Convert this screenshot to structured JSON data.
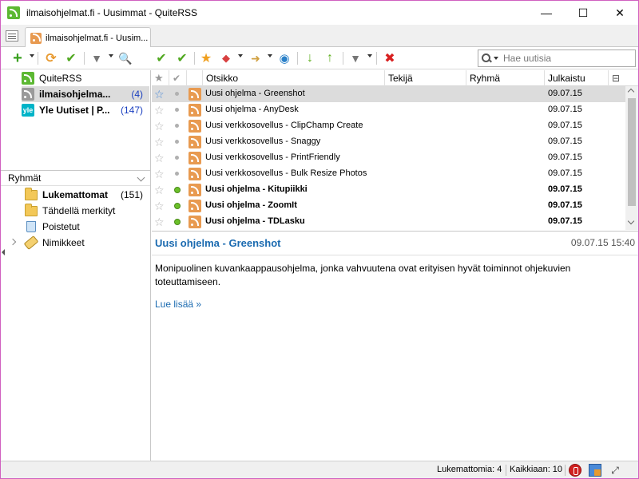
{
  "window": {
    "title": "ilmaisohjelmat.fi - Uusimmat - QuiteRSS",
    "controls": {
      "minimize": "—",
      "maximize": "☐",
      "close": "✕"
    }
  },
  "tabs": [
    {
      "label": "ilmaisohjelmat.fi - Uusim..."
    }
  ],
  "toolbar": {
    "left_icons": [
      "add-feed-icon",
      "update-icon",
      "mark-read-icon",
      "filter-icon",
      "find-feed-icon"
    ],
    "news_icons": [
      "mark-news-read-icon",
      "mark-all-read-icon",
      "star-icon",
      "label-icon",
      "share-icon",
      "open-browser-icon",
      "next-unread-icon",
      "prev-unread-icon",
      "news-filter-icon",
      "delete-icon"
    ]
  },
  "search": {
    "placeholder": "Hae uutisia"
  },
  "feeds": [
    {
      "label": "QuiteRSS",
      "count": "",
      "icon": "green",
      "bold": false
    },
    {
      "label": "ilmaisohjelma...",
      "count": "(4)",
      "icon": "gray",
      "bold": true
    },
    {
      "label": "Yle Uutiset | P...",
      "count": "(147)",
      "icon": "yle",
      "bold": true
    }
  ],
  "yle_icon_text": "yle",
  "groups": {
    "header": "Ryhmät",
    "items": [
      {
        "label": "Lukemattomat",
        "count": "(151)",
        "bold": true
      },
      {
        "label": "Tähdellä merkityt",
        "count": "",
        "bold": false
      },
      {
        "label": "Poistetut",
        "count": "",
        "bold": false
      },
      {
        "label": "Nimikkeet",
        "count": "",
        "bold": false
      }
    ]
  },
  "news_columns": {
    "title": "Otsikko",
    "author": "Tekijä",
    "category": "Ryhmä",
    "published": "Julkaistu"
  },
  "news": [
    {
      "title": "Uusi ohjelma - Greenshot",
      "date": "09.07.15",
      "unread": false,
      "starred": true,
      "selected": true
    },
    {
      "title": "Uusi ohjelma - AnyDesk",
      "date": "09.07.15",
      "unread": false,
      "starred": false,
      "selected": false
    },
    {
      "title": "Uusi verkkosovellus - ClipChamp Create",
      "date": "09.07.15",
      "unread": false,
      "starred": false,
      "selected": false
    },
    {
      "title": "Uusi verkkosovellus - Snaggy",
      "date": "09.07.15",
      "unread": false,
      "starred": false,
      "selected": false
    },
    {
      "title": "Uusi verkkosovellus - PrintFriendly",
      "date": "09.07.15",
      "unread": false,
      "starred": false,
      "selected": false
    },
    {
      "title": "Uusi verkkosovellus - Bulk Resize Photos",
      "date": "09.07.15",
      "unread": false,
      "starred": false,
      "selected": false
    },
    {
      "title": "Uusi ohjelma - Kitupiikki",
      "date": "09.07.15",
      "unread": true,
      "starred": false,
      "selected": false
    },
    {
      "title": "Uusi ohjelma - ZoomIt",
      "date": "09.07.15",
      "unread": true,
      "starred": false,
      "selected": false
    },
    {
      "title": "Uusi ohjelma - TDLasku",
      "date": "09.07.15",
      "unread": true,
      "starred": false,
      "selected": false
    }
  ],
  "preview": {
    "title": "Uusi ohjelma - Greenshot",
    "datetime": "09.07.15 15:40",
    "body": "Monipuolinen kuvankaappausohjelma, jonka vahvuutena ovat erityisen hyvät toiminnot ohjekuvien toteuttamiseen.",
    "link": "Lue lisää »"
  },
  "status": {
    "unread": "Lukemattomia: 4",
    "total": "Kaikkiaan: 10"
  },
  "colors": {
    "accent": "#1a6ab0",
    "selection": "#dcdcdc",
    "unread_dot": "#6bc02a",
    "rss_orange": "#e89a50",
    "quiterss_green": "#5cb832"
  }
}
